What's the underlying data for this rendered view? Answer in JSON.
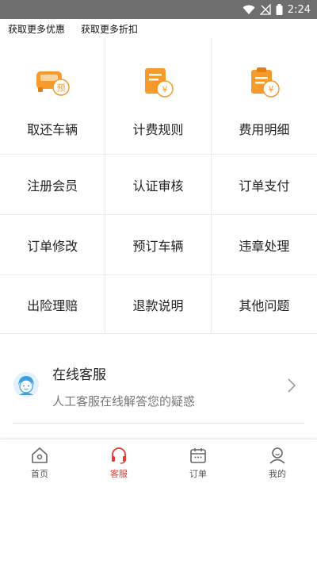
{
  "status_bar": {
    "time": "2:24"
  },
  "promo": {
    "left_label": "获取更多优惠",
    "right_label": "获取更多折扣"
  },
  "grid": {
    "featured": [
      {
        "label": "取还车辆",
        "icon": "car-reserve-icon",
        "badge": "预"
      },
      {
        "label": "计费规则",
        "icon": "bill-rules-icon",
        "badge": "¥"
      },
      {
        "label": "费用明细",
        "icon": "clipboard-fee-icon",
        "badge": "¥"
      }
    ],
    "rows": [
      [
        "注册会员",
        "认证审核",
        "订单支付"
      ],
      [
        "订单修改",
        "预订车辆",
        "违章处理"
      ],
      [
        "出险理赔",
        "退款说明",
        "其他问题"
      ]
    ]
  },
  "online_service": {
    "title": "在线客服",
    "subtitle": "人工客服在线解答您的疑惑"
  },
  "tabbar": {
    "items": [
      {
        "label": "首页",
        "icon": "home-icon"
      },
      {
        "label": "客服",
        "icon": "headset-icon",
        "active": true
      },
      {
        "label": "订单",
        "icon": "calendar-icon"
      },
      {
        "label": "我的",
        "icon": "user-icon"
      }
    ]
  },
  "colors": {
    "accent": "#e8382d",
    "icon_orange": "#f59a2b",
    "status_bar": "#6e6e6e"
  }
}
